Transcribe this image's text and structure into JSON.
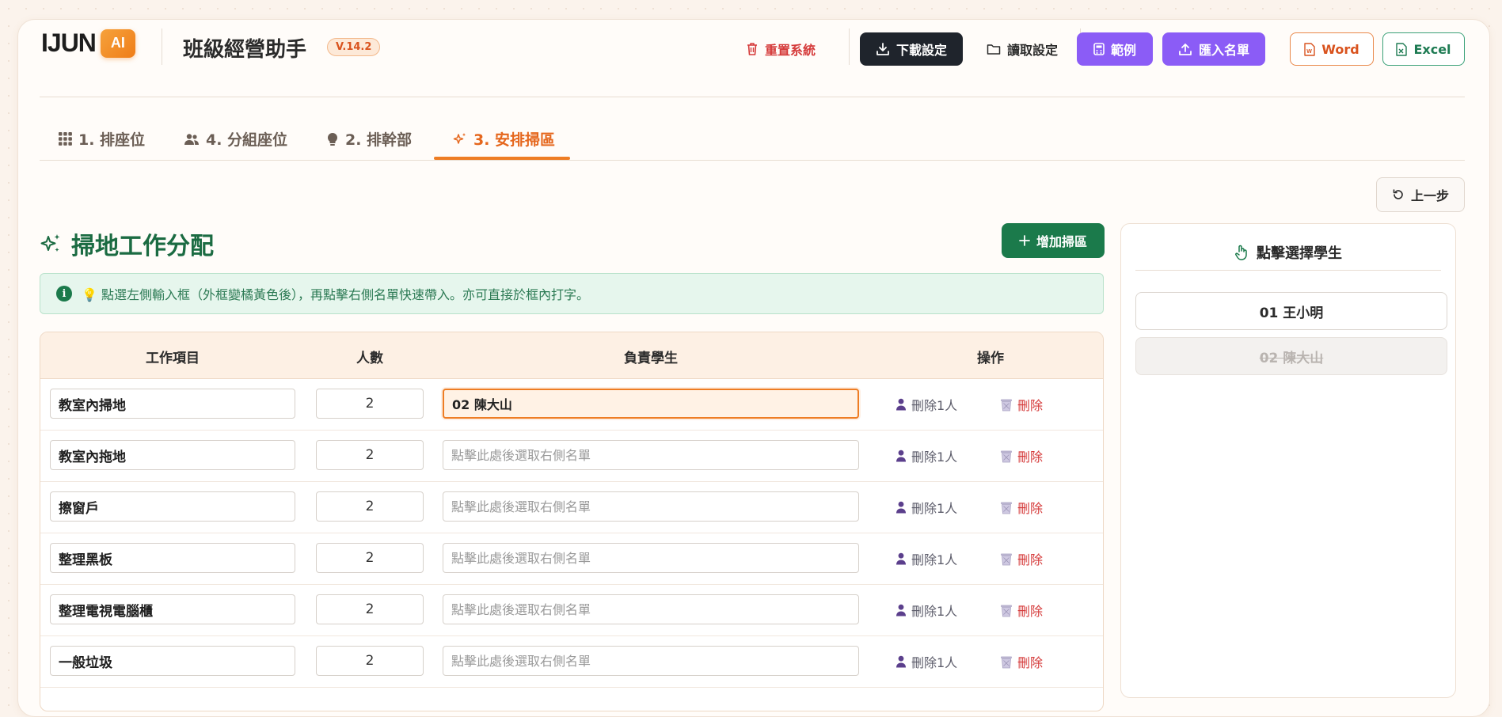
{
  "header": {
    "logo_text": "IJUN",
    "logo_badge": "AI",
    "app_title": "班級經營助手",
    "version": "V.14.2",
    "buttons": {
      "reset": "重置系統",
      "download": "下載設定",
      "read": "讀取設定",
      "example": "範例",
      "import": "匯入名單",
      "word": "Word",
      "excel": "Excel"
    }
  },
  "tabs": [
    {
      "label": "1. 排座位"
    },
    {
      "label": "4. 分組座位"
    },
    {
      "label": "2. 排幹部"
    },
    {
      "label": "3. 安排掃區"
    }
  ],
  "toolbar": {
    "undo": "上一步"
  },
  "section": {
    "title": "掃地工作分配",
    "add_button": "增加掃區",
    "info": "💡 點選左側輸入框（外框變橘黃色後），再點擊右側名單快速帶入。亦可直接於框內打字。"
  },
  "table": {
    "headers": {
      "task": "工作項目",
      "count": "人數",
      "student": "負責學生",
      "action": "操作"
    },
    "placeholder": "點擊此處後選取右側名單",
    "remove_one": "刪除1人",
    "delete": "刪除",
    "rows": [
      {
        "task": "教室內掃地",
        "count": "2",
        "student": "02 陳大山"
      },
      {
        "task": "教室內拖地",
        "count": "2",
        "student": ""
      },
      {
        "task": "擦窗戶",
        "count": "2",
        "student": ""
      },
      {
        "task": "整理黑板",
        "count": "2",
        "student": ""
      },
      {
        "task": "整理電視電腦櫃",
        "count": "2",
        "student": ""
      },
      {
        "task": "一般垃圾",
        "count": "2",
        "student": ""
      }
    ]
  },
  "panel": {
    "title": "點擊選擇學生",
    "students": [
      {
        "label": "01 王小明",
        "used": false
      },
      {
        "label": "02 陳大山",
        "used": true
      }
    ]
  },
  "colors": {
    "accent_orange": "#ee7d24",
    "green": "#1b7a4b",
    "purple": "#8b5cf6",
    "danger": "#d53a3a"
  }
}
